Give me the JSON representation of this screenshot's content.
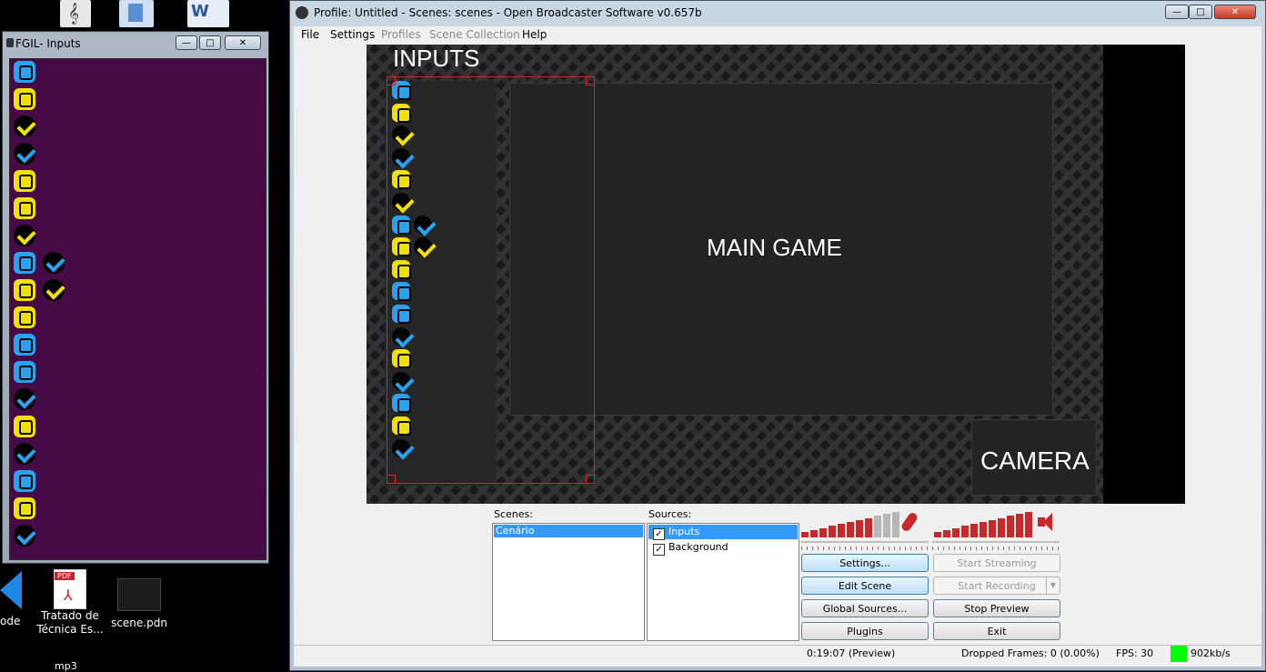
{
  "desktop": {
    "icons_bottom": [
      {
        "label_line1": "ode",
        "label_line2": ""
      },
      {
        "label_line1": "Tratado de",
        "label_line2": "Técnica Es...",
        "badge": "PDF"
      },
      {
        "label_line1": "scene.pdn",
        "label_line2": ""
      }
    ],
    "icon_bottom_partial": "mp3"
  },
  "fgil_window": {
    "title": "FGIL- Inputs",
    "buttons": {
      "minimize": "—",
      "maximize": "□",
      "close": "✕"
    },
    "background_color": "#460b46",
    "rows": [
      [
        "punch-blue"
      ],
      [
        "punch-yellow"
      ],
      [
        "kick-yellow"
      ],
      [
        "kick-blue"
      ],
      [
        "punch-yellow"
      ],
      [
        "punch-yellow"
      ],
      [
        "kick-yellow"
      ],
      [
        "punch-blue",
        "kick-blue"
      ],
      [
        "punch-yellow",
        "kick-yellow"
      ],
      [
        "punch-yellow"
      ],
      [
        "punch-blue"
      ],
      [
        "punch-blue"
      ],
      [
        "kick-blue"
      ],
      [
        "punch-yellow"
      ],
      [
        "kick-blue"
      ],
      [
        "punch-blue"
      ],
      [
        "punch-yellow"
      ],
      [
        "kick-blue"
      ]
    ]
  },
  "obs_window": {
    "title": "Profile: Untitled - Scenes: scenes - Open Broadcaster Software v0.657b",
    "menu": [
      {
        "label": "File",
        "enabled": true
      },
      {
        "label": "Settings",
        "enabled": true
      },
      {
        "label": "Profiles",
        "enabled": false
      },
      {
        "label": "Scene Collection",
        "enabled": false
      },
      {
        "label": "Help",
        "enabled": true
      }
    ],
    "preview": {
      "inputs_label": "INPUTS",
      "main_game_label": "MAIN GAME",
      "camera_label": "CAMERA",
      "rows": [
        [
          "punch-blue"
        ],
        [
          "punch-yellow"
        ],
        [
          "kick-yellow"
        ],
        [
          "kick-blue"
        ],
        [
          "punch-yellow"
        ],
        [
          "kick-yellow"
        ],
        [
          "punch-blue",
          "kick-blue"
        ],
        [
          "punch-yellow",
          "kick-yellow"
        ],
        [
          "punch-yellow"
        ],
        [
          "punch-blue"
        ],
        [
          "punch-blue"
        ],
        [
          "kick-blue"
        ],
        [
          "punch-yellow"
        ],
        [
          "kick-blue"
        ],
        [
          "punch-blue"
        ],
        [
          "punch-yellow"
        ],
        [
          "kick-blue"
        ]
      ]
    },
    "scenes": {
      "label": "Scenes:",
      "items": [
        {
          "name": "Cenário",
          "selected": true
        }
      ]
    },
    "sources": {
      "label": "Sources:",
      "items": [
        {
          "name": "Inputs",
          "checked": true,
          "selected": true
        },
        {
          "name": "Background",
          "checked": true,
          "selected": false
        }
      ]
    },
    "buttons": {
      "settings": "Settings...",
      "start_streaming": "Start Streaming",
      "edit_scene": "Edit Scene",
      "start_recording": "Start Recording",
      "global_sources": "Global Sources...",
      "stop_preview": "Stop Preview",
      "plugins": "Plugins",
      "exit": "Exit"
    },
    "mic_meter_level": 0.75,
    "desktop_meter_level": 1.0,
    "status": {
      "time": "0:19:07 (Preview)",
      "dropped_frames": "Dropped Frames: 0 (0.00%)",
      "fps": "FPS: 30",
      "bitrate": "902kb/s",
      "bitrate_color": "#00ff00"
    }
  }
}
